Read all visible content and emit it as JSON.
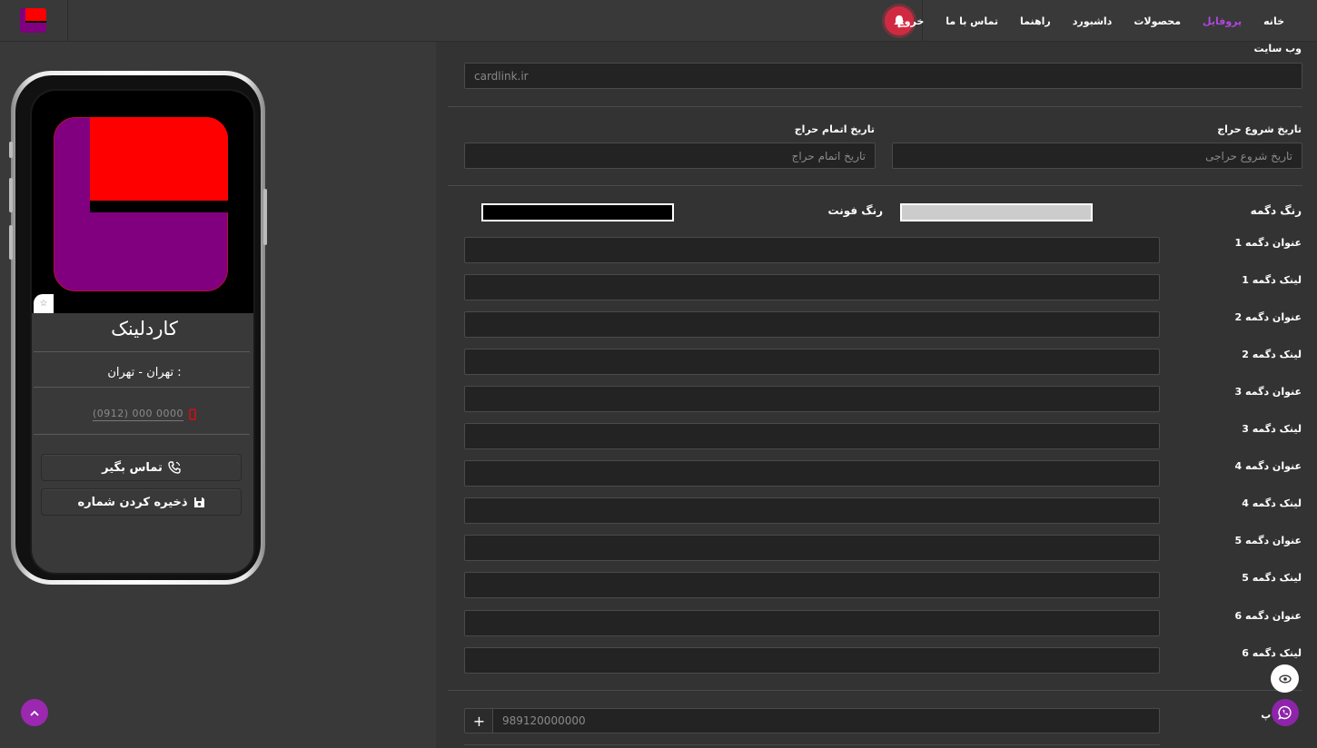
{
  "nav": {
    "items": [
      {
        "label": "خانه",
        "active": false
      },
      {
        "label": "پروفایل",
        "active": true
      },
      {
        "label": "محصولات",
        "active": false
      },
      {
        "label": "داشبورد",
        "active": false
      },
      {
        "label": "راهنما",
        "active": false
      },
      {
        "label": "تماس با ما",
        "active": false
      },
      {
        "label": "خروج",
        "active": false
      }
    ],
    "accent_color": "#b146e0",
    "bell_color": "#d02a43"
  },
  "preview": {
    "name": "کاردلینک",
    "location": "تهران - تهران :",
    "phone_placeholder": "(0912) 000 0000",
    "call_button": "تماس بگیر",
    "save_button": "ذخیره کردن شماره",
    "logo_colors": {
      "primary": "#800080",
      "secondary": "#ff0000"
    }
  },
  "form": {
    "website_label": "وب سایت",
    "website_value": "cardlink.ir",
    "auction_start_label": "تاریخ شروع حراج",
    "auction_start_placeholder": "تاریخ شروع حراجی",
    "auction_end_label": "تاریخ اتمام حراج",
    "auction_end_placeholder": "تاریخ اتمام حراج",
    "button_color_label": "رنگ دگمه",
    "button_color_value": "#cccccc",
    "font_color_label": "رنگ فونت",
    "font_color_value": "#000000",
    "buttons": [
      {
        "title_label": "عنوان دگمه 1",
        "link_label": "لینک دگمه 1"
      },
      {
        "title_label": "عنوان دگمه 2",
        "link_label": "لینک دگمه 2"
      },
      {
        "title_label": "عنوان دگمه 3",
        "link_label": "لینک دگمه 3"
      },
      {
        "title_label": "عنوان دگمه 4",
        "link_label": "لینک دگمه 4"
      },
      {
        "title_label": "عنوان دگمه 5",
        "link_label": "لینک دگمه 5"
      },
      {
        "title_label": "عنوان دگمه 6",
        "link_label": "لینک دگمه 6"
      }
    ],
    "whatsapp_label": "و    پ",
    "whatsapp_prefix": "+",
    "whatsapp_placeholder": "989120000000"
  }
}
